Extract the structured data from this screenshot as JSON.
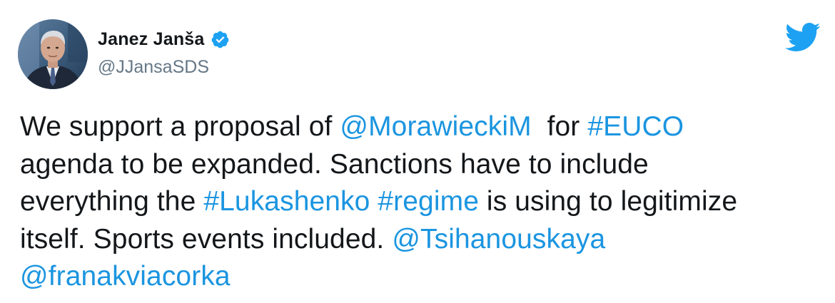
{
  "author": {
    "display_name": "Janez Janša",
    "handle": "@JJansaSDS",
    "verified": true,
    "avatar_icon": "profile-photo"
  },
  "brand": {
    "icon": "twitter-bird-icon",
    "color": "#1da1f2"
  },
  "colors": {
    "text": "#14171a",
    "secondary": "#657786",
    "link": "#1b95e0",
    "verified_badge": "#1da1f2"
  },
  "tweet": {
    "lines": [
      [
        {
          "t": "We support a proposal of ",
          "link": false
        },
        {
          "t": "@MorawieckiM",
          "link": true
        },
        {
          "t": "  for ",
          "link": false
        },
        {
          "t": "#EUCO",
          "link": true
        }
      ],
      [
        {
          "t": "agenda to be expanded. Sanctions have to include",
          "link": false
        }
      ],
      [
        {
          "t": "everything the ",
          "link": false
        },
        {
          "t": "#Lukashenko",
          "link": true
        },
        {
          "t": " ",
          "link": false
        },
        {
          "t": "#regime",
          "link": true
        },
        {
          "t": " is using to legitimize",
          "link": false
        }
      ],
      [
        {
          "t": "itself. Sports events included. ",
          "link": false
        },
        {
          "t": "@Tsihanouskaya",
          "link": true
        }
      ],
      [
        {
          "t": "@franakviacorka",
          "link": true
        }
      ]
    ]
  }
}
